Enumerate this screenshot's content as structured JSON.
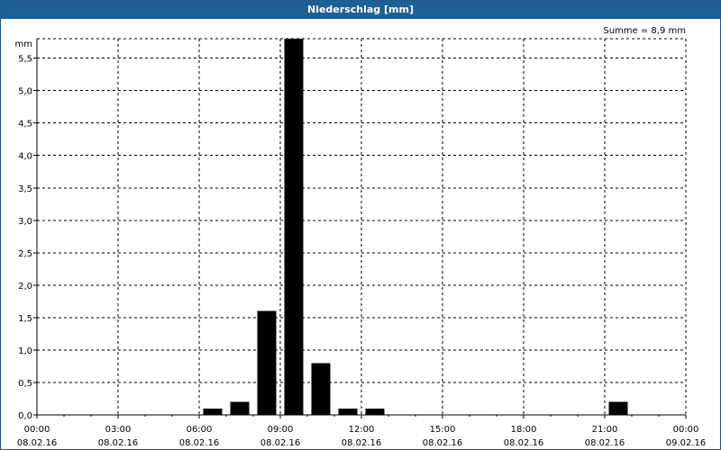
{
  "window": {
    "title": "Niederschlag [mm]"
  },
  "chart_data": {
    "type": "bar",
    "title": "Niederschlag [mm]",
    "ylabel": "mm",
    "annotation": "Summe = 8,9 mm",
    "ylim": [
      0,
      5.8
    ],
    "y_ticks": [
      "0,0",
      "0,5",
      "1,0",
      "1,5",
      "2,0",
      "2,5",
      "3,0",
      "3,5",
      "4,0",
      "4,5",
      "5,0",
      "5,5"
    ],
    "x_ticks": [
      {
        "time": "00:00",
        "date": "08.02.16"
      },
      {
        "time": "03:00",
        "date": "08.02.16"
      },
      {
        "time": "06:00",
        "date": "08.02.16"
      },
      {
        "time": "09:00",
        "date": "08.02.16"
      },
      {
        "time": "12:00",
        "date": "08.02.16"
      },
      {
        "time": "15:00",
        "date": "08.02.16"
      },
      {
        "time": "18:00",
        "date": "08.02.16"
      },
      {
        "time": "21:00",
        "date": "08.02.16"
      },
      {
        "time": "00:00",
        "date": "09.02.16"
      }
    ],
    "grid": true,
    "bars": [
      {
        "x": "06:00–07:00",
        "value": 0.1
      },
      {
        "x": "07:00–08:00",
        "value": 0.2
      },
      {
        "x": "08:00–09:00",
        "value": 1.6
      },
      {
        "x": "09:00–10:00",
        "value": 5.8
      },
      {
        "x": "10:00–11:00",
        "value": 0.8
      },
      {
        "x": "11:00–12:00",
        "value": 0.1
      },
      {
        "x": "12:00–13:00",
        "value": 0.1
      },
      {
        "x": "21:00–22:00",
        "value": 0.2
      }
    ],
    "colors": {
      "bar": "#000000",
      "grid": "#000000",
      "titlebar": "#1e5f96"
    }
  }
}
